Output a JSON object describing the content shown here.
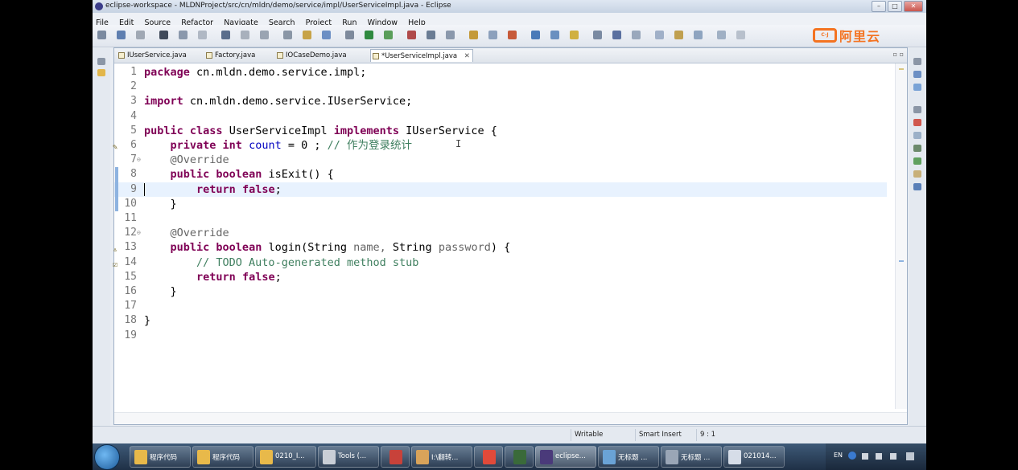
{
  "window": {
    "title": "eclipse-workspace - MLDNProject/src/cn/mldn/demo/service/impl/UserServiceImpl.java - Eclipse",
    "controls": [
      "–",
      "□",
      "✕"
    ]
  },
  "menu": [
    "File",
    "Edit",
    "Source",
    "Refactor",
    "Navigate",
    "Search",
    "Project",
    "Run",
    "Window",
    "Help"
  ],
  "logo": {
    "badge": "C-J",
    "text": "阿里云"
  },
  "tabs": [
    {
      "label": "IUserService.java",
      "active": false
    },
    {
      "label": "Factory.java",
      "active": false
    },
    {
      "label": "IOCaseDemo.java",
      "active": false
    },
    {
      "label": "*UserServiceImpl.java",
      "active": true,
      "close": "✕"
    }
  ],
  "tab_controls": "▫ ▫",
  "code_lines": [
    {
      "n": "1",
      "html_key": "l1"
    },
    {
      "n": "2",
      "html_key": "l2"
    },
    {
      "n": "3",
      "html_key": "l3"
    },
    {
      "n": "4",
      "html_key": "l4"
    },
    {
      "n": "5",
      "html_key": "l5"
    },
    {
      "n": "6",
      "html_key": "l6"
    },
    {
      "n": "7",
      "html_key": "l7"
    },
    {
      "n": "8",
      "html_key": "l8"
    },
    {
      "n": "9",
      "html_key": "l9"
    },
    {
      "n": "10",
      "html_key": "l10"
    },
    {
      "n": "11",
      "html_key": "l11"
    },
    {
      "n": "12",
      "html_key": "l12"
    },
    {
      "n": "13",
      "html_key": "l13"
    },
    {
      "n": "14",
      "html_key": "l14"
    },
    {
      "n": "15",
      "html_key": "l15"
    },
    {
      "n": "16",
      "html_key": "l16"
    },
    {
      "n": "17",
      "html_key": "l17"
    },
    {
      "n": "18",
      "html_key": "l18"
    },
    {
      "n": "19",
      "html_key": "l19"
    }
  ],
  "code": {
    "l1": [
      [
        "kw",
        "package"
      ],
      [
        "",
        "cn.mldn.demo.service.impl;"
      ]
    ],
    "l2": [],
    "l3": [
      [
        "kw",
        "import"
      ],
      [
        "",
        "cn.mldn.demo.service.IUserService;"
      ]
    ],
    "l4": [],
    "l5": [
      [
        "kw",
        "public"
      ],
      [
        "kw",
        "class"
      ],
      [
        "",
        "UserServiceImpl"
      ],
      [
        "kw",
        "implements"
      ],
      [
        "",
        "IUserService {"
      ]
    ],
    "l6": [
      [
        "",
        "    "
      ],
      [
        "kw",
        "private"
      ],
      [
        "kw",
        "int"
      ],
      [
        "fld",
        "count"
      ],
      [
        "",
        "= 0 ;"
      ],
      [
        "cm",
        "// 作为登录统计"
      ]
    ],
    "l7": [
      [
        "",
        "    "
      ],
      [
        "ann",
        "@Override"
      ]
    ],
    "l8": [
      [
        "",
        "    "
      ],
      [
        "kw",
        "public"
      ],
      [
        "kw",
        "boolean"
      ],
      [
        "",
        "isExit() {"
      ]
    ],
    "l9": [
      [
        "",
        "        "
      ],
      [
        "kw",
        "return"
      ],
      [
        "kw",
        "false"
      ],
      [
        "",
        ";"
      ]
    ],
    "l10": [
      [
        "",
        "    }"
      ]
    ],
    "l11": [],
    "l12": [
      [
        "",
        "    "
      ],
      [
        "ann",
        "@Override"
      ]
    ],
    "l13": [
      [
        "",
        "    "
      ],
      [
        "kw",
        "public"
      ],
      [
        "kw",
        "boolean"
      ],
      [
        "",
        "login(String"
      ],
      [
        "ann",
        "name,"
      ],
      [
        "",
        "String"
      ],
      [
        "ann",
        "password"
      ],
      [
        "",
        ") {"
      ]
    ],
    "l14": [
      [
        "",
        "        "
      ],
      [
        "cm",
        "// TODO Auto-generated method stub"
      ]
    ],
    "l15": [
      [
        "",
        "        "
      ],
      [
        "kw",
        "return"
      ],
      [
        "kw",
        "false"
      ],
      [
        "",
        ";"
      ]
    ],
    "l16": [
      [
        "",
        "    }"
      ]
    ],
    "l17": [],
    "l18": [
      [
        "",
        "}"
      ]
    ],
    "l19": []
  },
  "status": {
    "writable": "Writable",
    "insert_mode": "Smart Insert",
    "position": "9 : 1"
  },
  "taskbar": [
    {
      "label": "程序代码",
      "color": "#e8b94a",
      "active": false
    },
    {
      "label": "程序代码",
      "color": "#e8b94a",
      "active": false
    },
    {
      "label": "0210_I...",
      "color": "#e8b94a",
      "active": false
    },
    {
      "label": "Tools (...",
      "color": "#c9ced6",
      "active": false
    },
    {
      "label": "",
      "color": "#c8423a",
      "active": false
    },
    {
      "label": "I:\\翻转...",
      "color": "#d9a35a",
      "active": false
    },
    {
      "label": "",
      "color": "#e04a3a",
      "active": false
    },
    {
      "label": "",
      "color": "#3a6a3a",
      "active": false
    },
    {
      "label": "eclipse...",
      "color": "#4a3a7a",
      "active": true
    },
    {
      "label": "无标题 ...",
      "color": "#6aa3d6",
      "active": false
    },
    {
      "label": "无标题 ...",
      "color": "#9aa6b6",
      "active": false
    },
    {
      "label": "021014...",
      "color": "#d6dde8",
      "active": false
    }
  ],
  "tray": {
    "lang": "EN"
  }
}
